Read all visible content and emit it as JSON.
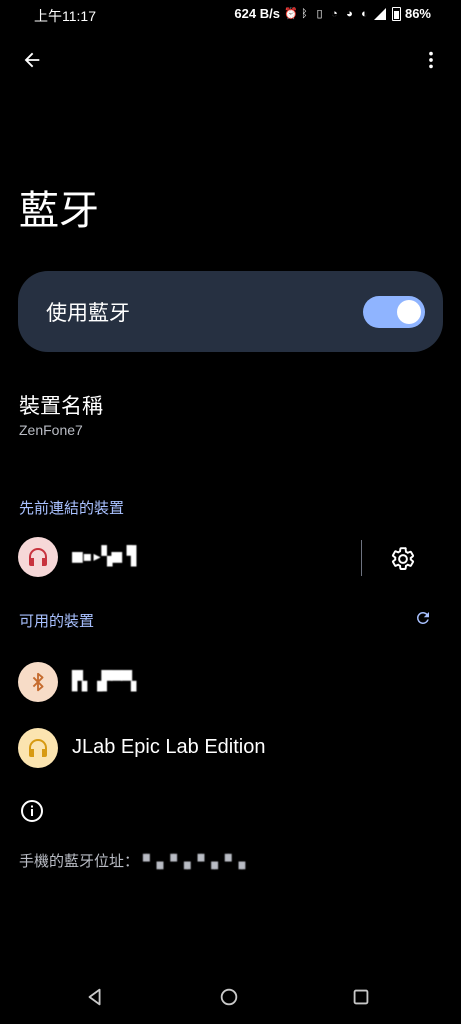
{
  "status_bar": {
    "time": "上午11:17",
    "net_speed": "624 B/s",
    "battery": "86%"
  },
  "page_title": "藍牙",
  "bluetooth_toggle": {
    "label": "使用藍牙",
    "enabled": true,
    "accent_color": "#8fb4ff"
  },
  "device_name": {
    "title": "裝置名稱",
    "value": "ZenFone7"
  },
  "previously_connected": {
    "header": "先前連結的裝置",
    "devices": [
      {
        "name": "■▪▸▚■▝▌",
        "icon": "headphones-icon",
        "icon_bg": "#f6d8d8",
        "icon_color": "#c8333e"
      }
    ]
  },
  "available_devices": {
    "header": "可用的裝置",
    "devices": [
      {
        "name": "▛▖▗▛▀▀▖",
        "icon": "bluetooth-icon",
        "icon_bg": "#f7dcc7",
        "icon_color": "#c56b2e"
      },
      {
        "name": "JLab Epic Lab Edition",
        "icon": "headphones-icon",
        "icon_bg": "#fbe4b0",
        "icon_color": "#d79a12"
      }
    ]
  },
  "footer": {
    "address_label": "手機的藍牙位址：",
    "address_value": "▝▘▗▖▝▘▗▖▝▘▗▖▝▘▗▖"
  }
}
